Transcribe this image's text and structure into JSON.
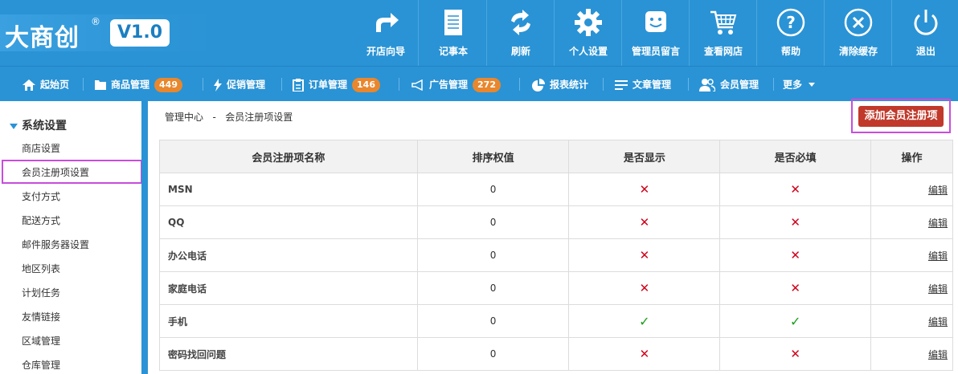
{
  "logo": {
    "brand": "大商创",
    "reg": "®",
    "version": "V1.0"
  },
  "toolbar": [
    {
      "label": "开店向导",
      "icon": "share-arrow-icon"
    },
    {
      "label": "记事本",
      "icon": "notepad-icon"
    },
    {
      "label": "刷新",
      "icon": "refresh-icon"
    },
    {
      "label": "个人设置",
      "icon": "gear-icon"
    },
    {
      "label": "管理员留言",
      "icon": "message-smile-icon"
    },
    {
      "label": "查看网店",
      "icon": "cart-icon"
    },
    {
      "label": "帮助",
      "icon": "help-icon"
    },
    {
      "label": "清除缓存",
      "icon": "clear-icon"
    },
    {
      "label": "退出",
      "icon": "power-icon"
    }
  ],
  "nav": [
    {
      "label": "起始页",
      "icon": "home-icon"
    },
    {
      "label": "商品管理",
      "icon": "folder-icon",
      "badge": "449"
    },
    {
      "label": "促销管理",
      "icon": "lightning-icon"
    },
    {
      "label": "订单管理",
      "icon": "clipboard-icon",
      "badge": "146"
    },
    {
      "label": "广告管理",
      "icon": "megaphone-icon",
      "badge": "272"
    },
    {
      "label": "报表统计",
      "icon": "pie-chart-icon"
    },
    {
      "label": "文章管理",
      "icon": "list-icon"
    },
    {
      "label": "会员管理",
      "icon": "users-icon"
    },
    {
      "label": "更多",
      "icon": "caret-down-icon"
    }
  ],
  "sidebar": {
    "section": "系统设置",
    "items": [
      "商店设置",
      "会员注册项设置",
      "支付方式",
      "配送方式",
      "邮件服务器设置",
      "地区列表",
      "计划任务",
      "友情链接",
      "区域管理",
      "仓库管理"
    ]
  },
  "breadcrumb": {
    "root": "管理中心",
    "sep": "-",
    "current": "会员注册项设置"
  },
  "add_button": "添加会员注册项",
  "table": {
    "headers": [
      "会员注册项名称",
      "排序权值",
      "是否显示",
      "是否必填",
      "操作"
    ],
    "edit_label": "编辑",
    "rows": [
      {
        "name": "MSN",
        "order": "0",
        "show": false,
        "required": false
      },
      {
        "name": "QQ",
        "order": "0",
        "show": false,
        "required": false
      },
      {
        "name": "办公电话",
        "order": "0",
        "show": false,
        "required": false
      },
      {
        "name": "家庭电话",
        "order": "0",
        "show": false,
        "required": false
      },
      {
        "name": "手机",
        "order": "0",
        "show": true,
        "required": true
      },
      {
        "name": "密码找回问题",
        "order": "0",
        "show": false,
        "required": false
      }
    ]
  },
  "colors": {
    "primary": "#2a93d5",
    "danger": "#c0392b",
    "badge": "#e8872e",
    "highlight": "#c74ddc"
  }
}
